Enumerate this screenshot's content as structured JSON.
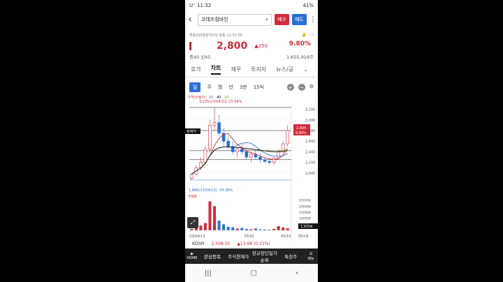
{
  "status": {
    "left": "U⁺ 11:32",
    "right": "41%"
  },
  "header": {
    "stock_name": "코데즈컴바인",
    "buy_label": "매수",
    "sell_label": "매도"
  },
  "info": {
    "subtitle": "변동성완화장치(VI) 발동 11:31:55"
  },
  "price": {
    "current": "2,800",
    "change": "▲250",
    "percent": "9.80%",
    "vol_ratio": "증40 신45",
    "volume": "1,655,418주"
  },
  "tabs": [
    "호가",
    "차트",
    "재무",
    "투자자",
    "뉴스/공"
  ],
  "toolbar": {
    "items": [
      "일",
      "주",
      "월",
      "년",
      "3분",
      "15틱"
    ]
  },
  "chart_data": {
    "type": "candlestick",
    "legend": [
      "가격(수정)",
      "5",
      "10",
      "40",
      "20"
    ],
    "annotations": {
      "high": "3,235(23/04/21) 15.54%",
      "low": "1,866(23/04/13) -33.36%",
      "current_box": "현재가",
      "price_tag_1": "2,800",
      "price_tag_2": "9.80%"
    },
    "y_ticks": [
      "3,200",
      "3,000",
      "2,800",
      "2,600",
      "2,400",
      "2,200",
      "2,000"
    ],
    "x_ticks": [
      "23/04/13",
      "05/02",
      "05/15",
      "05/18"
    ],
    "volume_label": "거래량",
    "volume_ticks": [
      "25000K",
      "20000K",
      "15000K",
      "10000K",
      "5000K"
    ],
    "volume_tag": "1,655K",
    "candles": [
      {
        "o": 1900,
        "h": 2000,
        "l": 1866,
        "c": 1980
      },
      {
        "o": 1980,
        "h": 2150,
        "l": 1950,
        "c": 2100
      },
      {
        "o": 2100,
        "h": 2300,
        "l": 2050,
        "c": 2200
      },
      {
        "o": 2200,
        "h": 2500,
        "l": 2150,
        "c": 2450
      },
      {
        "o": 2450,
        "h": 3000,
        "l": 2400,
        "c": 2900
      },
      {
        "o": 2900,
        "h": 3235,
        "l": 2800,
        "c": 2950
      },
      {
        "o": 2950,
        "h": 3100,
        "l": 2700,
        "c": 2750
      },
      {
        "o": 2750,
        "h": 2850,
        "l": 2500,
        "c": 2600
      },
      {
        "o": 2600,
        "h": 2700,
        "l": 2450,
        "c": 2500
      },
      {
        "o": 2500,
        "h": 2600,
        "l": 2350,
        "c": 2400
      },
      {
        "o": 2400,
        "h": 2500,
        "l": 2300,
        "c": 2450
      },
      {
        "o": 2450,
        "h": 2550,
        "l": 2350,
        "c": 2400
      },
      {
        "o": 2400,
        "h": 2480,
        "l": 2250,
        "c": 2300
      },
      {
        "o": 2300,
        "h": 2400,
        "l": 2200,
        "c": 2350
      },
      {
        "o": 2350,
        "h": 2420,
        "l": 2250,
        "c": 2300
      },
      {
        "o": 2300,
        "h": 2380,
        "l": 2200,
        "c": 2250
      },
      {
        "o": 2250,
        "h": 2300,
        "l": 2180,
        "c": 2220
      },
      {
        "o": 2220,
        "h": 2260,
        "l": 2150,
        "c": 2200
      },
      {
        "o": 2200,
        "h": 2300,
        "l": 2150,
        "c": 2280
      },
      {
        "o": 2280,
        "h": 2450,
        "l": 2250,
        "c": 2400
      },
      {
        "o": 2400,
        "h": 2600,
        "l": 2350,
        "c": 2550
      },
      {
        "o": 2550,
        "h": 2900,
        "l": 2500,
        "c": 2800
      }
    ],
    "volume": [
      1200,
      2500,
      4000,
      6000,
      24000,
      20000,
      8000,
      5000,
      3000,
      2500,
      1500,
      2000,
      1200,
      900,
      1500,
      800,
      700,
      600,
      1200,
      3500,
      2500,
      1655
    ]
  },
  "kospi": {
    "name": "KOSPI",
    "value": "2,508.35",
    "change": "▲13.68 (0.55%)"
  },
  "bottomnav": {
    "home": "HOME",
    "items": [
      "관심종목",
      "주식현재가",
      "장규장단일가순위",
      "특징주"
    ],
    "menu": "메뉴"
  }
}
